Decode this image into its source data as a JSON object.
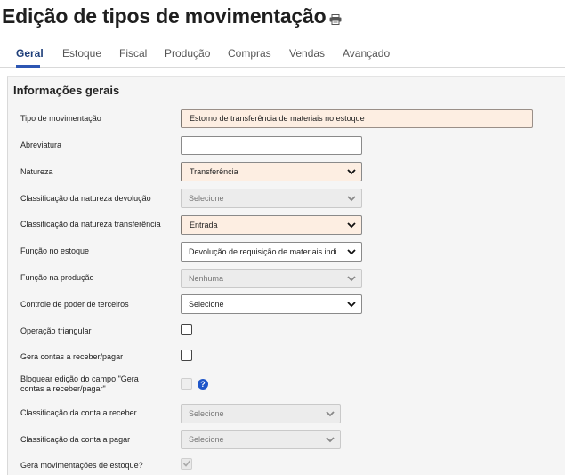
{
  "page": {
    "title": "Edição de tipos de movimentação",
    "print_icon": "printer-icon"
  },
  "tabs": [
    {
      "label": "Geral",
      "active": true
    },
    {
      "label": "Estoque"
    },
    {
      "label": "Fiscal"
    },
    {
      "label": "Produção"
    },
    {
      "label": "Compras"
    },
    {
      "label": "Vendas"
    },
    {
      "label": "Avançado"
    }
  ],
  "section": {
    "title": "Informações gerais"
  },
  "fields": {
    "tipo_movimentacao": {
      "label": "Tipo de movimentação",
      "value": "Estorno de transferência de materiais no estoque"
    },
    "abreviatura": {
      "label": "Abreviatura",
      "value": ""
    },
    "natureza": {
      "label": "Natureza",
      "value": "Transferência"
    },
    "class_nat_devolucao": {
      "label": "Classificação da natureza devolução",
      "value": "Selecione"
    },
    "class_nat_transferencia": {
      "label": "Classificação da natureza transferência",
      "value": "Entrada"
    },
    "funcao_estoque": {
      "label": "Função no estoque",
      "value": "Devolução de requisição de materiais indi"
    },
    "funcao_producao": {
      "label": "Função na produção",
      "value": "Nenhuma"
    },
    "controle_terceiros": {
      "label": "Controle de poder de terceiros",
      "value": "Selecione"
    },
    "operacao_triangular": {
      "label": "Operação triangular",
      "checked": false
    },
    "gera_contas": {
      "label": "Gera contas a receber/pagar",
      "checked": false
    },
    "bloquear_edicao": {
      "label_line1": "Bloquear edição do campo \"Gera",
      "label_line2": "contas a receber/pagar\"",
      "checked": false,
      "help": "?"
    },
    "class_conta_receber": {
      "label": "Classificação da conta a receber",
      "value": "Selecione"
    },
    "class_conta_pagar": {
      "label": "Classificação da conta a pagar",
      "value": "Selecione"
    },
    "gera_mov_estoque": {
      "label": "Gera movimentações de estoque?",
      "checked": true
    }
  },
  "colors": {
    "accent": "#2d56b3",
    "required_bg": "#fdeee2",
    "help": "#1f56c9"
  }
}
